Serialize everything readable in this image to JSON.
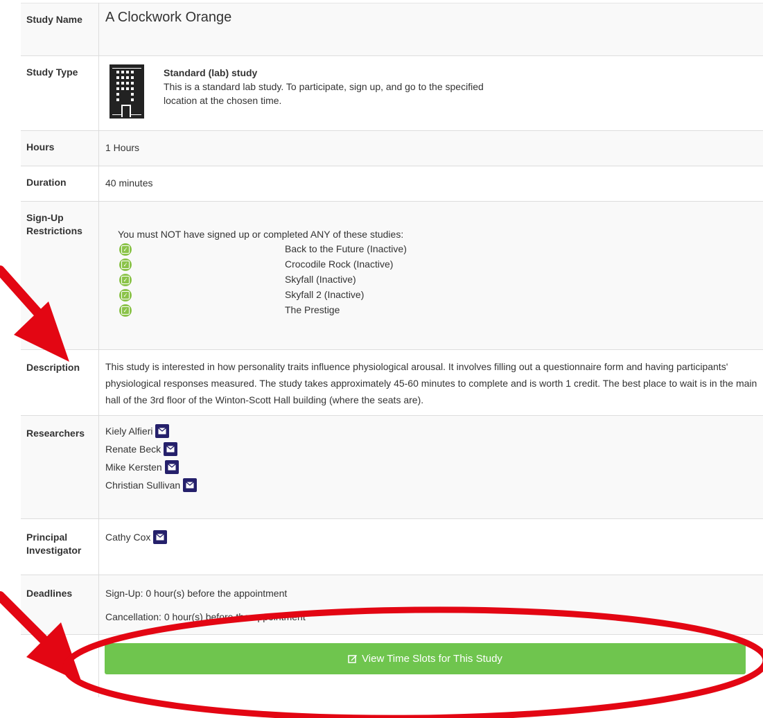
{
  "study": {
    "name_label": "Study Name",
    "name": "A Clockwork Orange",
    "type_label": "Study Type",
    "type_title": "Standard (lab) study",
    "type_desc_1": "This is a standard lab study. To participate, sign up, and go to the specified",
    "type_desc_2": "location at the chosen time.",
    "type_icon": "building-icon",
    "hours_label": "Hours",
    "hours": "1 Hours",
    "duration_label": "Duration",
    "duration": "40 minutes",
    "restrictions_label_1": "Sign-Up",
    "restrictions_label_2": "Restrictions",
    "restrictions_intro": "You must NOT have signed up or completed ANY of these studies:",
    "restrictions": [
      "Back to the Future  (Inactive)",
      "Crocodile Rock  (Inactive)",
      "Skyfall  (Inactive)",
      "Skyfall 2  (Inactive)",
      "The Prestige"
    ],
    "description_label": "Description",
    "description": "This study is interested in how personality traits influence physiological arousal. It involves filling out a questionnaire form and having participants' physiological responses measured. The study takes approximately 45-60 minutes to complete and is worth 1 credit. The best place to wait is in the main hall of the 3rd floor of the Winton-Scott Hall building (where the seats are).",
    "researchers_label": "Researchers",
    "researchers": [
      "Kiely Alfieri",
      "Renate Beck",
      "Mike Kersten",
      "Christian Sullivan"
    ],
    "pi_label_1": "Principal",
    "pi_label_2": "Investigator",
    "pi": "Cathy Cox",
    "deadlines_label": "Deadlines",
    "signup_deadline": "Sign-Up:  0 hour(s) before the appointment",
    "cancel_deadline": "Cancellation:  0 hour(s) before the appointment",
    "view_slots_button": "View Time Slots for This Study"
  },
  "colors": {
    "button": "#6fc54e",
    "check": "#8bc34a",
    "mail": "#25206b",
    "annotation": "#e30613"
  }
}
